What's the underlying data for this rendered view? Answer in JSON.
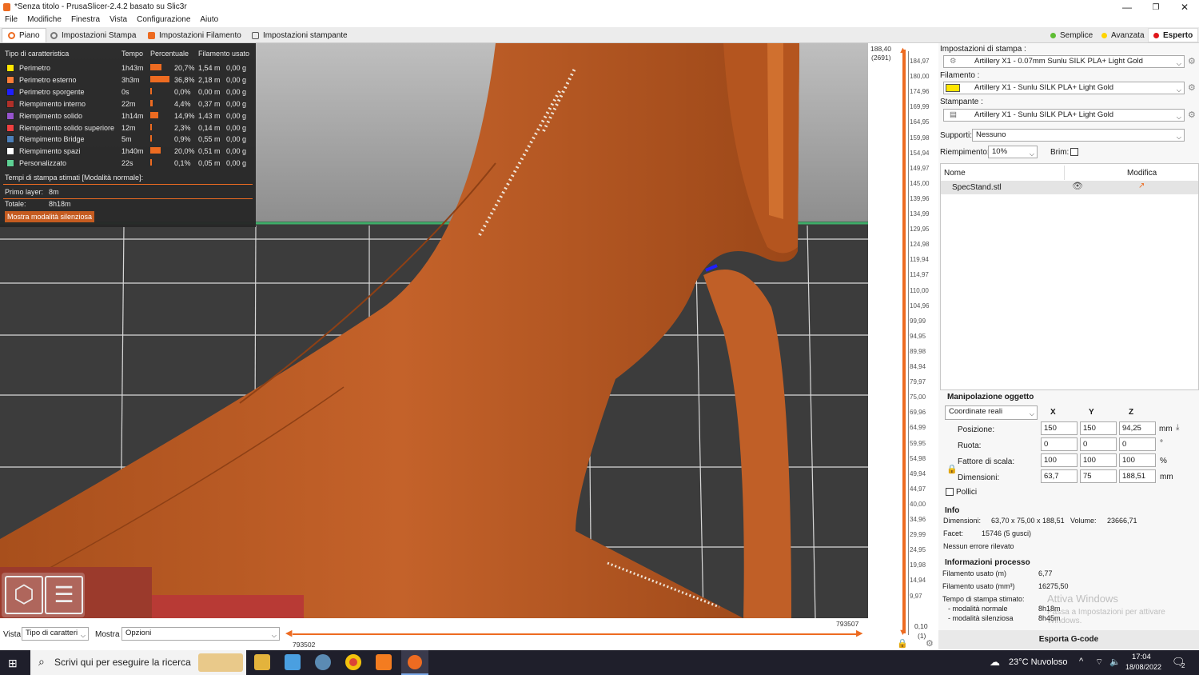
{
  "window": {
    "title": "*Senza titolo - PrusaSlicer-2.4.2 basato su Slic3r",
    "minimize": "—",
    "maximize": "❐",
    "close": "✕"
  },
  "menu": [
    "File",
    "Modifiche",
    "Finestra",
    "Vista",
    "Configurazione",
    "Aiuto"
  ],
  "tabs": [
    {
      "label": "Piano",
      "icon": "plater-icon"
    },
    {
      "label": "Impostazioni Stampa",
      "icon": "print-settings-icon"
    },
    {
      "label": "Impostazioni Filamento",
      "icon": "filament-icon"
    },
    {
      "label": "Impostazioni stampante",
      "icon": "printer-icon"
    }
  ],
  "modes": [
    {
      "label": "Semplice",
      "color": "#5ebd33"
    },
    {
      "label": "Avanzata",
      "color": "#ffd400"
    },
    {
      "label": "Esperto",
      "color": "#e0161a"
    }
  ],
  "legend": {
    "headers": [
      "Tipo di caratteristica",
      "Tempo",
      "Percentuale",
      "Filamento usato"
    ],
    "rows": [
      {
        "name": "Perimetro",
        "color": "#ffe600",
        "time": "1h43m",
        "pct": "20,7%",
        "pct_value": 20.7,
        "len": "1,54 m",
        "weight": "0,00 g"
      },
      {
        "name": "Perimetro esterno",
        "color": "#ff7d38",
        "time": "3h3m",
        "pct": "36,8%",
        "pct_value": 36.8,
        "len": "2,18 m",
        "weight": "0,00 g"
      },
      {
        "name": "Perimetro sporgente",
        "color": "#1f1fff",
        "time": "0s",
        "pct": "0,0%",
        "pct_value": 0,
        "len": "0,00 m",
        "weight": "0,00 g"
      },
      {
        "name": "Riempimento interno",
        "color": "#b03029",
        "time": "22m",
        "pct": "4,4%",
        "pct_value": 4.4,
        "len": "0,37 m",
        "weight": "0,00 g"
      },
      {
        "name": "Riempimento solido",
        "color": "#9654cc",
        "time": "1h14m",
        "pct": "14,9%",
        "pct_value": 14.9,
        "len": "1,43 m",
        "weight": "0,00 g"
      },
      {
        "name": "Riempimento solido superiore",
        "color": "#f04040",
        "time": "12m",
        "pct": "2,3%",
        "pct_value": 2.3,
        "len": "0,14 m",
        "weight": "0,00 g"
      },
      {
        "name": "Riempimento Bridge",
        "color": "#4d80ba",
        "time": "5m",
        "pct": "0,9%",
        "pct_value": 0.9,
        "len": "0,55 m",
        "weight": "0,00 g"
      },
      {
        "name": "Riempimento spazi",
        "color": "#ffffff",
        "time": "1h40m",
        "pct": "20,0%",
        "pct_value": 20.0,
        "len": "0,51 m",
        "weight": "0,00 g"
      },
      {
        "name": "Personalizzato",
        "color": "#5ed194",
        "time": "22s",
        "pct": "0,1%",
        "pct_value": 0.1,
        "len": "0,05 m",
        "weight": "0,00 g"
      }
    ],
    "est_title": "Tempi di stampa stimati [Modalità normale]:",
    "first_layer_label": "Primo layer:",
    "first_layer": "8m",
    "total_label": "Totale:",
    "total": "8h18m",
    "silent_button": "Mostra modalità silenziosa"
  },
  "vslider": {
    "top_value": "188,40",
    "top_layer": "(2691)",
    "bottom_value": "0,10",
    "bottom_layer": "(1)",
    "ticks": [
      "184,97",
      "180,00",
      "174,96",
      "169,99",
      "164,95",
      "159,98",
      "154,94",
      "149,97",
      "145,00",
      "139,96",
      "134,99",
      "129,95",
      "124,98",
      "119,94",
      "114,97",
      "110,00",
      "104,96",
      "99,99",
      "94,95",
      "89,98",
      "84,94",
      "79,97",
      "75,00",
      "69,96",
      "64,99",
      "59,95",
      "54,98",
      "49,94",
      "44,97",
      "40,00",
      "34,96",
      "29,99",
      "24,95",
      "19,98",
      "14,94",
      "9,97"
    ]
  },
  "hslider": {
    "right_value": "793507",
    "left_value": "793502"
  },
  "bottom": {
    "view_label": "Vista",
    "view_value": "Tipo di caratteri",
    "show_label": "Mostra",
    "show_value": "Opzioni"
  },
  "right": {
    "print_label": "Impostazioni di stampa :",
    "print_value": "Artillery X1 - 0.07mm Sunlu SILK PLA+ Light Gold",
    "filament_label": "Filamento :",
    "filament_value": "Artillery X1 - Sunlu SILK PLA+ Light Gold",
    "filament_color": "#ffe600",
    "printer_label": "Stampante :",
    "printer_value": "Artillery X1 - Sunlu SILK PLA+ Light Gold",
    "supports_label": "Supporti:",
    "supports_value": "Nessuno",
    "infill_label": "Riempimento:",
    "infill_value": "10%",
    "brim_label": "Brim:",
    "list_headers": [
      "Nome",
      "Modifica"
    ],
    "object_name": "SpecStand.stl",
    "manip_title": "Manipolazione oggetto",
    "coord_value": "Coordinate reali",
    "axes": [
      "X",
      "Y",
      "Z"
    ],
    "position_label": "Posizione:",
    "position": [
      "150",
      "150",
      "94,25"
    ],
    "position_unit": "mm",
    "rotation_label": "Ruota:",
    "rotation": [
      "0",
      "0",
      "0"
    ],
    "rotation_unit": "°",
    "scale_label": "Fattore di scala:",
    "scale": [
      "100",
      "100",
      "100"
    ],
    "scale_unit": "%",
    "size_label": "Dimensioni:",
    "size": [
      "63,7",
      "75",
      "188,51"
    ],
    "size_unit": "mm",
    "inches_label": "Pollici",
    "info_title": "Info",
    "dim_label": "Dimensioni:",
    "dim_value": "63,70 x 75,00 x 188,51",
    "volume_label": "Volume:",
    "volume_value": "23666,71",
    "facets_label": "Facet:",
    "facets_value": "15746 (5 gusci)",
    "errors": "Nessun errore rilevato",
    "process_title": "Informazioni processo",
    "fil_m_label": "Filamento usato (m)",
    "fil_m": "6,77",
    "fil_mm3_label": "Filamento usato (mm³)",
    "fil_mm3": "16275,50",
    "time_label": "Tempo di stampa stimato:",
    "normal_label": "- modalità normale",
    "normal": "8h18m",
    "silent_label": "- modalità silenziosa",
    "silent": "8h45m",
    "watermark1": "Attiva Windows",
    "watermark2": "Passa a Impostazioni per attivare Windows.",
    "export_button": "Esporta G-code"
  },
  "taskbar": {
    "search_placeholder": "Scrivi qui per eseguire la ricerca",
    "weather": "23°C  Nuvoloso",
    "time": "17:04",
    "date": "18/08/2022",
    "notif": "2"
  }
}
